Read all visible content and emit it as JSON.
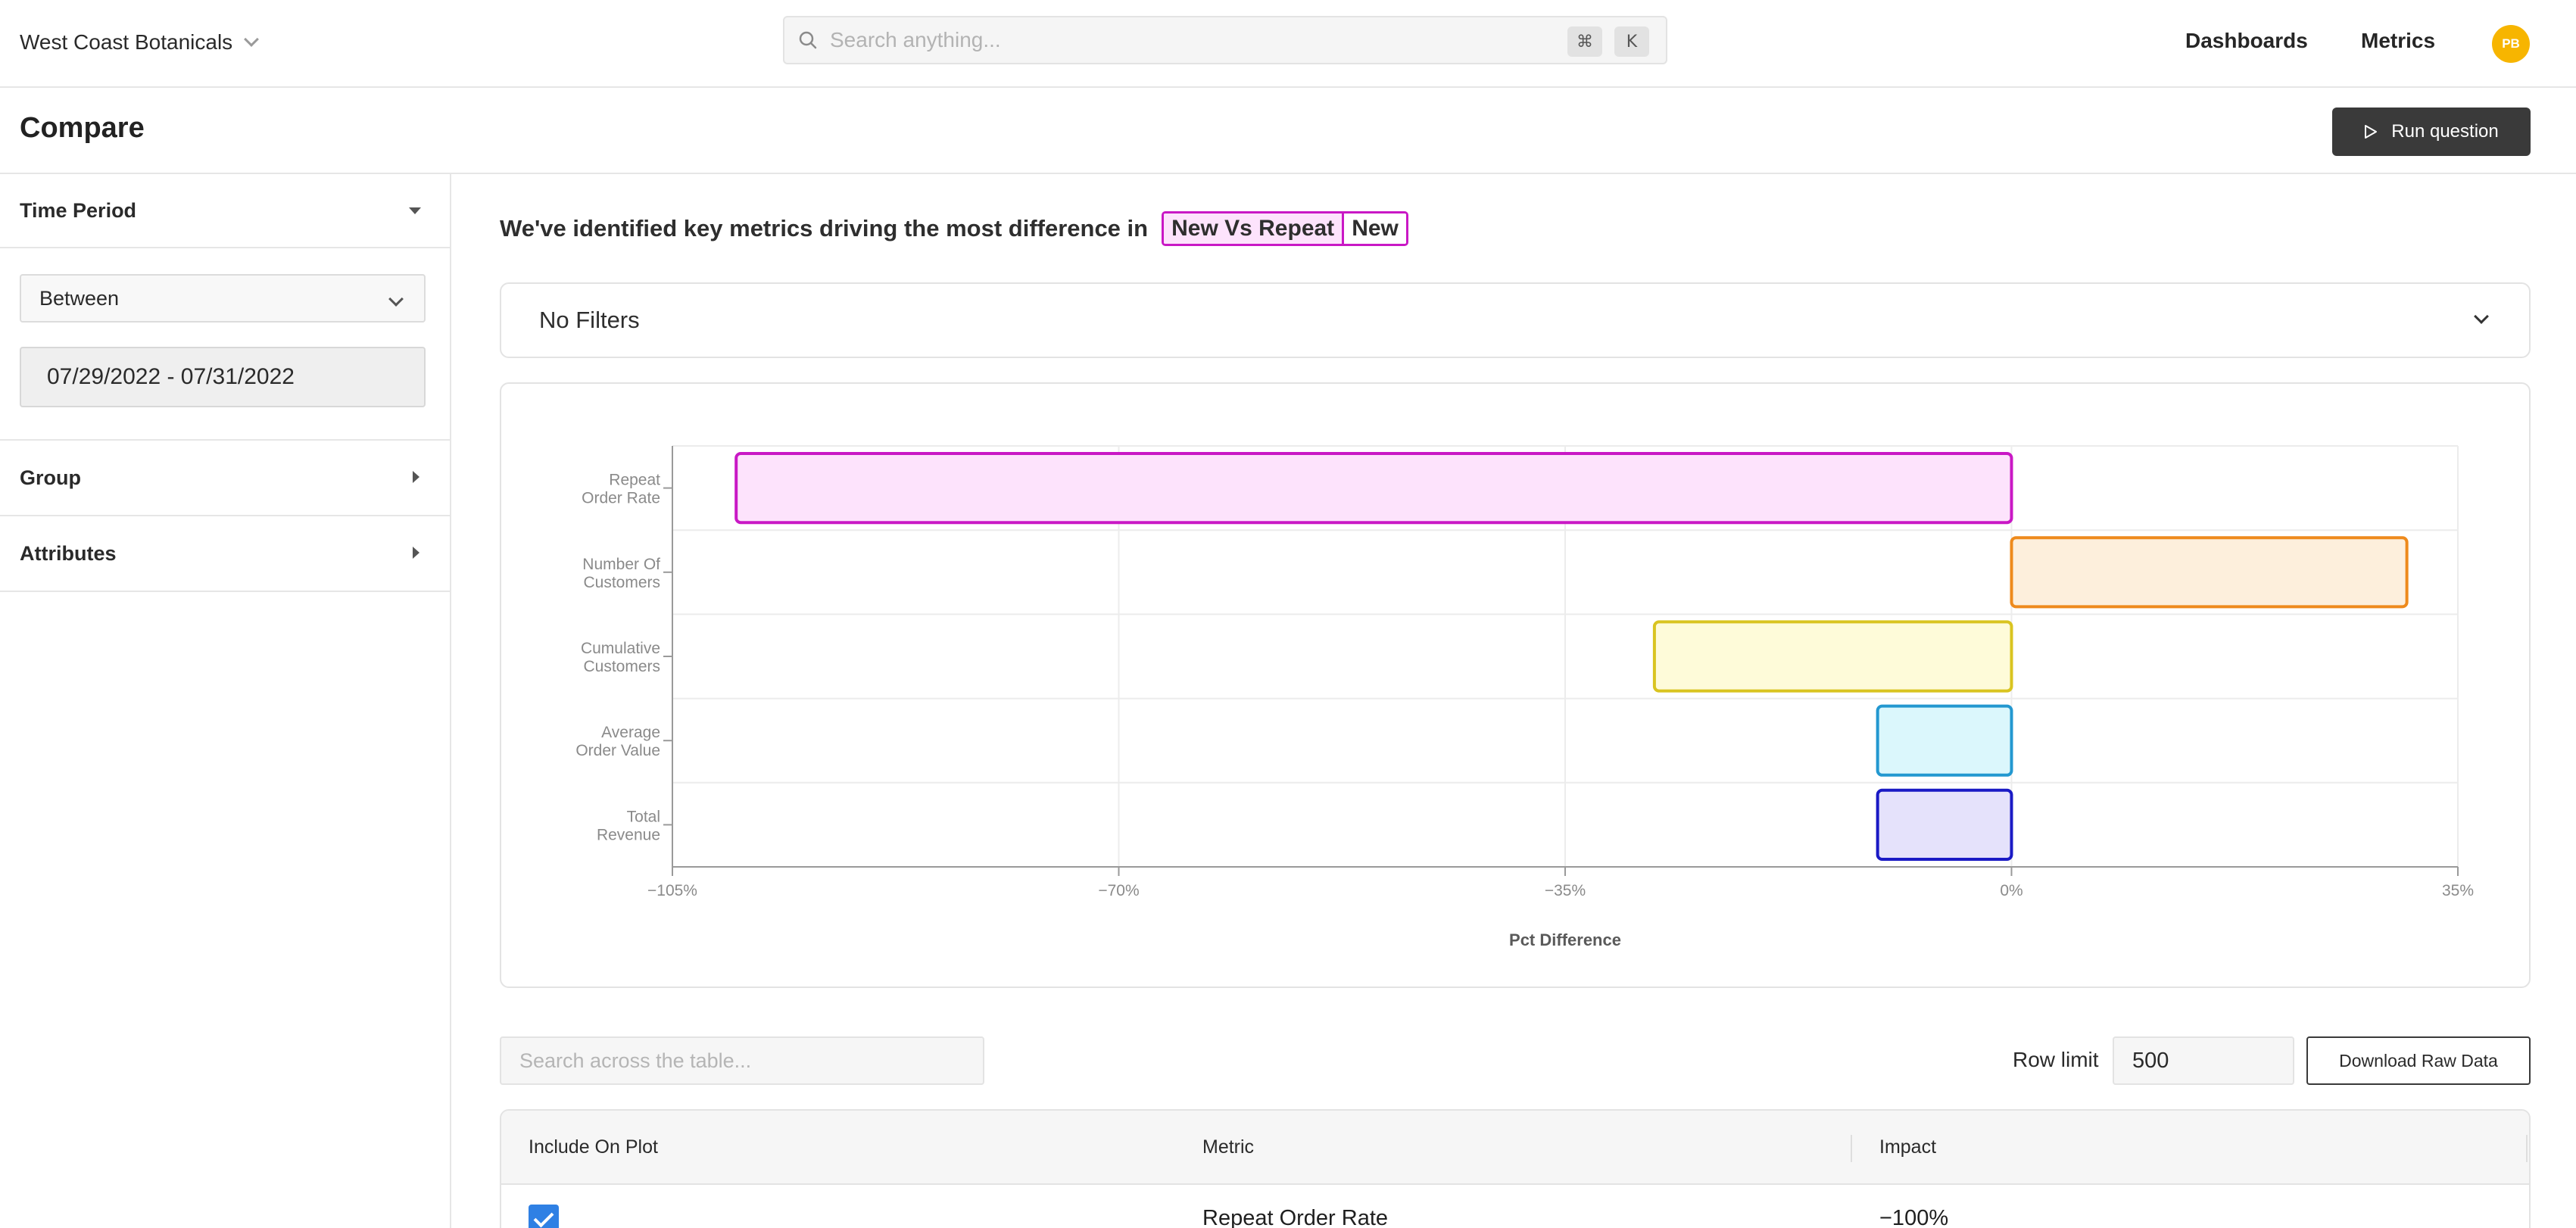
{
  "topbar": {
    "org_name": "West Coast Botanicals",
    "search_placeholder": "Search anything...",
    "shortcut_key1": "⌘",
    "shortcut_key2": "K",
    "nav": [
      "Dashboards",
      "Metrics"
    ],
    "avatar_initials": "PB",
    "avatar_color": "#f7b500"
  },
  "page": {
    "title": "Compare",
    "run_button": "Run question"
  },
  "sidebar": {
    "time_period": {
      "label": "Time Period",
      "mode": "Between",
      "date_range": "07/29/2022 - 07/31/2022"
    },
    "group_label": "Group",
    "attributes_label": "Attributes"
  },
  "main": {
    "headline": "We've identified key metrics driving the most difference in",
    "pill_a": "New Vs Repeat",
    "pill_b": "New",
    "filters_label": "No Filters",
    "table_search_placeholder": "Search across the table...",
    "row_limit_label": "Row limit",
    "row_limit_value": "500",
    "download_button": "Download Raw Data",
    "table": {
      "columns": [
        "Include On Plot",
        "Metric",
        "Impact"
      ],
      "rows": [
        {
          "include": true,
          "metric": "Repeat Order Rate",
          "impact": "−100%"
        }
      ]
    }
  },
  "chart_data": {
    "type": "bar",
    "orientation": "horizontal",
    "xlabel": "Pct Difference",
    "xlim": [
      -105,
      35
    ],
    "xticks": [
      "−105%",
      "−70%",
      "−35%",
      "0%",
      "35%"
    ],
    "xtick_values": [
      -105,
      -70,
      -35,
      0,
      35
    ],
    "categories": [
      [
        "Repeat",
        "Order Rate"
      ],
      [
        "Number Of",
        "Customers"
      ],
      [
        "Cumulative",
        "Customers"
      ],
      [
        "Average",
        "Order Value"
      ],
      [
        "Total",
        "Revenue"
      ]
    ],
    "values": [
      -100,
      31,
      -28,
      -10.5,
      -10.5
    ],
    "colors": [
      {
        "stroke": "#c918c5",
        "fill": "#fde3fc"
      },
      {
        "stroke": "#ee8a1c",
        "fill": "#fdefdc"
      },
      {
        "stroke": "#d9c420",
        "fill": "#fefbd9"
      },
      {
        "stroke": "#2398d0",
        "fill": "#dbf7fc"
      },
      {
        "stroke": "#1a1ac5",
        "fill": "#e5e2fb"
      }
    ],
    "grid": true
  }
}
